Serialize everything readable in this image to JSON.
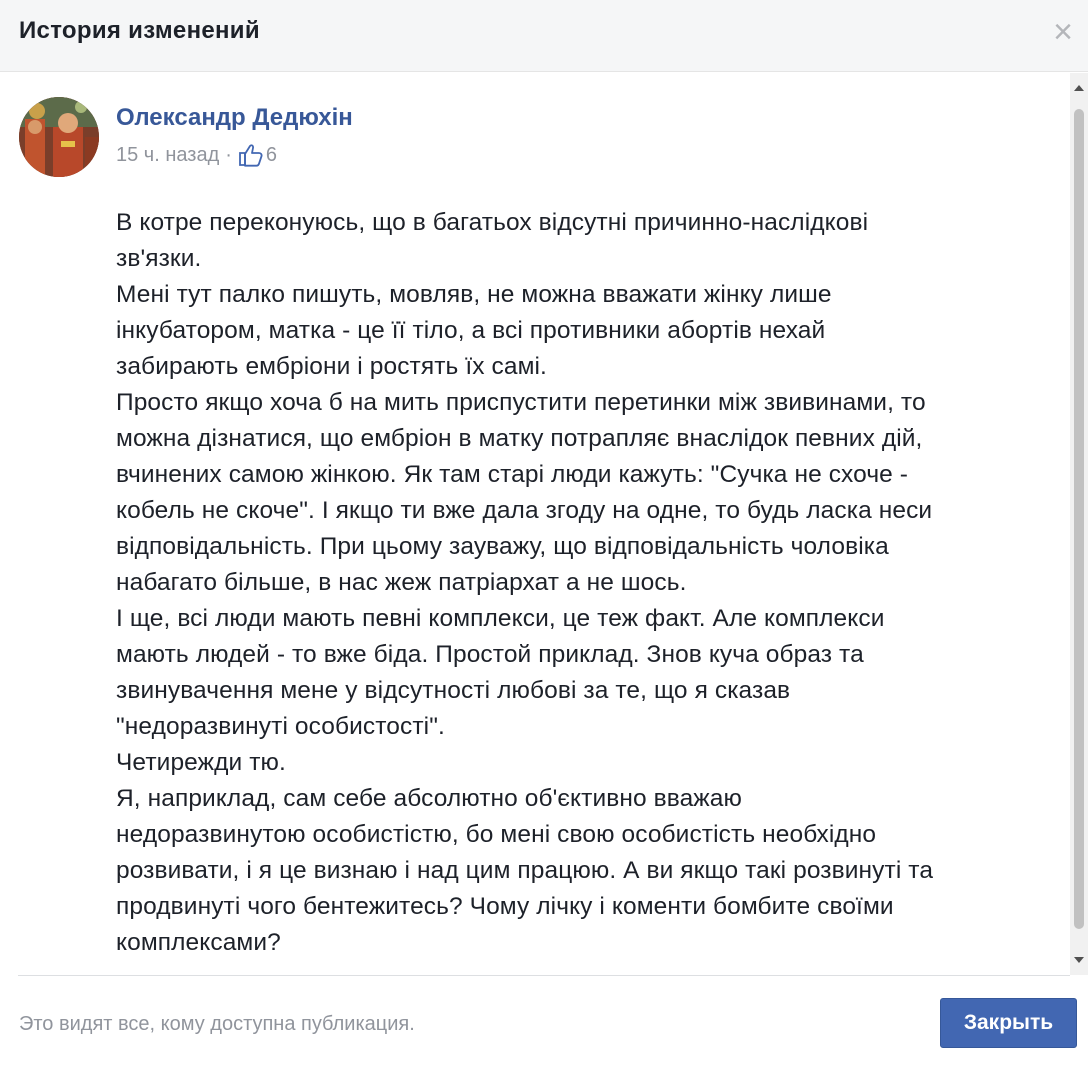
{
  "dialog": {
    "title": "История изменений",
    "close_icon": "close-icon"
  },
  "post": {
    "author": "Олександр Дедюхін",
    "time": "15 ч. назад",
    "separator": "·",
    "like_icon": "thumbs-up-icon",
    "likes": "6",
    "paragraphs": [
      "В котре переконуюсь, що в багатьох відсутні причинно-наслідкові\nзв'язки.",
      "Мені тут палко пишуть, мовляв, не можна вважати жінку лише\nінкубатором, матка - це її тіло, а всі противники абортів нехай\nзабирають ембріони і ростять їх самі.",
      "Просто якщо хоча б на мить приспустити перетинки між звивинами, то\nможна дізнатися, що ембріон в матку потрапляє внаслідок певних дій,\nвчинених самою жінкою. Як там старі люди кажуть: \"Сучка не схоче -\nкобель не скоче\". І якщо ти вже дала згоду на одне, то будь ласка неси\nвідповідальність. При цьому зауважу, що відповідальність чоловіка\nнабагато більше, в нас жеж патріархат а не шось.",
      "І ще, всі люди мають певні комплекси, це теж факт. Але комплекси\nмають людей - то вже біда. Простой приклад. Знов куча образ та\nзвинувачення мене у відсутності любові за те, що я сказав\n\"недоразвинуті особистості\".",
      "Четирежди тю.",
      "Я, наприклад, сам себе абсолютно об'єктивно вважаю\nнедоразвинутою особистістю, бо мені свою особистість необхідно\nрозвивати, і я це визнаю і над цим працюю. А ви якщо такі розвинуті та\nпродвинуті чого бентежитесь? Чому лічку і коменти бомбите своїми\nкомплексами?"
    ]
  },
  "footer": {
    "note": "Это видят все, кому доступна публикация.",
    "close_button": "Закрыть"
  },
  "colors": {
    "accent": "#4267b2",
    "author_link": "#385898",
    "muted": "#90949c",
    "header_bg": "#f5f6f7"
  }
}
